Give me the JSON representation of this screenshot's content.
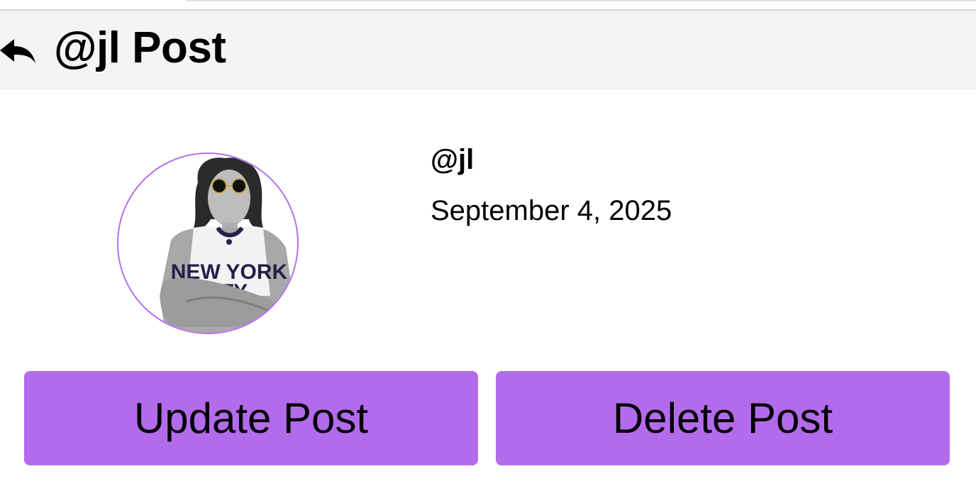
{
  "header": {
    "title": "@jl Post",
    "back_icon": "reply-arrow-icon"
  },
  "post": {
    "author": "@jl",
    "date": "September 4, 2025",
    "avatar_icon": "profile-photo",
    "avatar_shirt_text": [
      "NEW YORK",
      "CITY"
    ]
  },
  "actions": {
    "update_label": "Update Post",
    "delete_label": "Delete Post"
  },
  "colors": {
    "accent": "#b36bec",
    "header_bg": "#f4f4f4",
    "text": "#000000"
  }
}
